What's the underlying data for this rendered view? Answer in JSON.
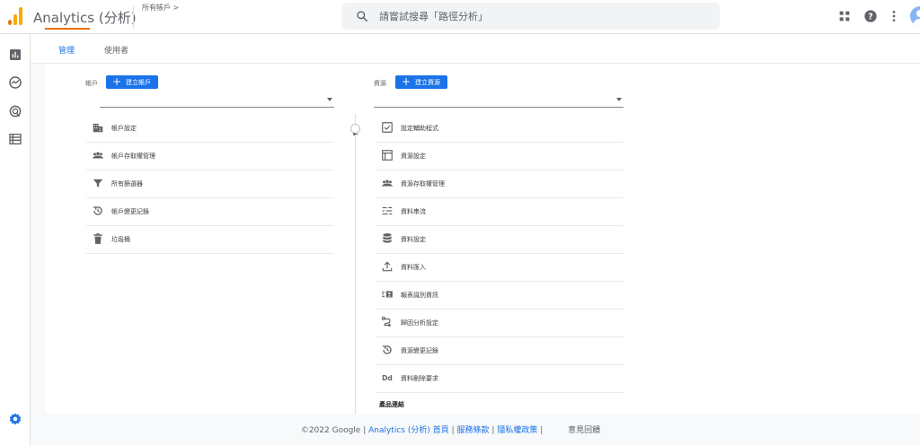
{
  "app": {
    "title": "Analytics (分析)"
  },
  "header": {
    "account_breadcrumb": "所有帳戶 >",
    "account_name": "",
    "search": {
      "placeholder": "請嘗試搜尋「路徑分析」"
    },
    "icons": [
      "apps-grid-icon",
      "help-icon",
      "more-vert-icon",
      "avatar"
    ]
  },
  "sidenav": {
    "icons": [
      "reports-icon",
      "explore-icon",
      "advertising-icon",
      "configure-icon",
      "admin-gear-icon"
    ]
  },
  "tabs": [
    {
      "label": "管理",
      "active": true
    },
    {
      "label": "使用者",
      "active": false
    }
  ],
  "account_column": {
    "label": "帳戶",
    "create_button": "建立帳戶",
    "selected": "",
    "items": [
      {
        "label": "帳戶設定",
        "icon": "building-icon"
      },
      {
        "label": "帳戶存取權管理",
        "icon": "people-icon"
      },
      {
        "label": "所有篩選器",
        "icon": "filter-icon"
      },
      {
        "label": "帳戶變更記錄",
        "icon": "history-icon"
      },
      {
        "label": "垃圾桶",
        "icon": "trash-icon"
      }
    ]
  },
  "property_column": {
    "label": "資源",
    "create_button": "建立資源",
    "selected": "",
    "items": [
      {
        "label": "設定輔助程式",
        "icon": "checkbox-icon"
      },
      {
        "label": "資源設定",
        "icon": "layout-icon"
      },
      {
        "label": "資源存取權管理",
        "icon": "people-icon"
      },
      {
        "label": "資料串流",
        "icon": "stream-icon"
      },
      {
        "label": "資料設定",
        "icon": "database-icon"
      },
      {
        "label": "資料匯入",
        "icon": "upload-icon"
      },
      {
        "label": "報表識別資訊",
        "icon": "identity-icon"
      },
      {
        "label": "歸因分析設定",
        "icon": "attribution-icon"
      },
      {
        "label": "資源變更記錄",
        "icon": "history-icon"
      },
      {
        "label": "資料刪除要求",
        "icon": "dd-icon"
      }
    ],
    "section_heading": "產品連結"
  },
  "footer": {
    "copyright": "©2022 Google |",
    "home_link": "Analytics (分析) 首頁",
    "sep1": "|",
    "terms_link": "服務條款",
    "sep2": "|",
    "privacy_link": "隱私權政策",
    "sep3": "|",
    "feedback": "意見回饋"
  },
  "colors": {
    "accent": "#1a73e8",
    "tab_indicator": "#e8710a",
    "logo_orange": "#f9ab00",
    "logo_dark_orange": "#e37400"
  }
}
